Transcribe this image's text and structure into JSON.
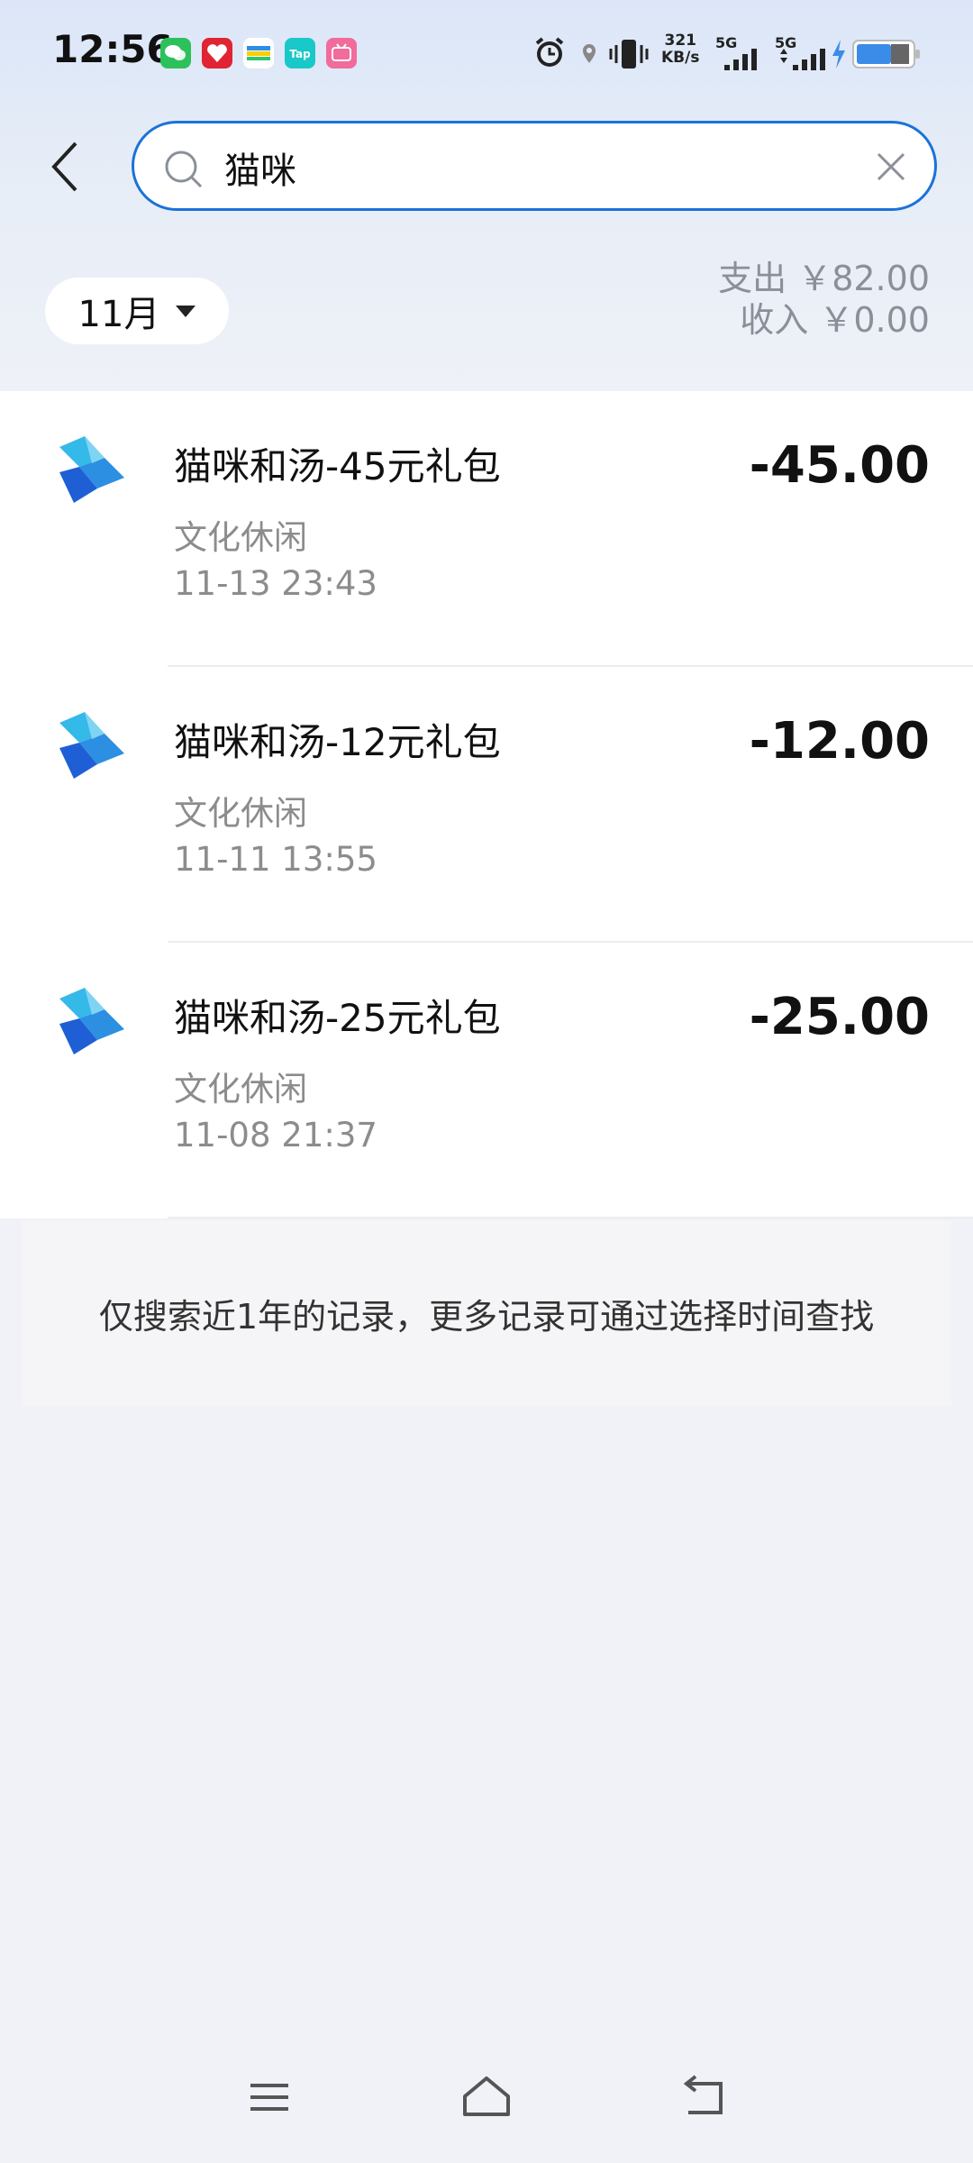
{
  "status_bar": {
    "time": "12:56",
    "net_speed_value": "321",
    "net_speed_unit": "KB/s",
    "signal1_label": "5G",
    "signal2_label": "5G",
    "icons": [
      "wechat-icon",
      "app-red-icon",
      "app-stripe-icon",
      "taptap-icon",
      "bilibili-icon",
      "alarm-icon",
      "location-icon",
      "vibrate-icon",
      "signal-icon",
      "signal-icon",
      "charging-icon",
      "battery-icon"
    ]
  },
  "search": {
    "value": "猫咪",
    "icon": "search-icon",
    "clear_icon": "close-icon",
    "back_icon": "chevron-left-icon"
  },
  "filter": {
    "month": "11月",
    "expense": "支出 ￥82.00",
    "income": "收入 ￥0.00"
  },
  "transactions": [
    {
      "title": "猫咪和汤-45元礼包",
      "category": "文化休闲",
      "datetime": "11-13 23:43",
      "amount": "-45.00"
    },
    {
      "title": "猫咪和汤-12元礼包",
      "category": "文化休闲",
      "datetime": "11-11 13:55",
      "amount": "-12.00"
    },
    {
      "title": "猫咪和汤-25元礼包",
      "category": "文化休闲",
      "datetime": "11-08 21:37",
      "amount": "-25.00"
    }
  ],
  "notice": "仅搜索近1年的记录，更多记录可通过选择时间查找",
  "colors": {
    "accent": "#1a73d9",
    "background": "#f0f2f7",
    "muted_text": "#8c8c8c"
  }
}
